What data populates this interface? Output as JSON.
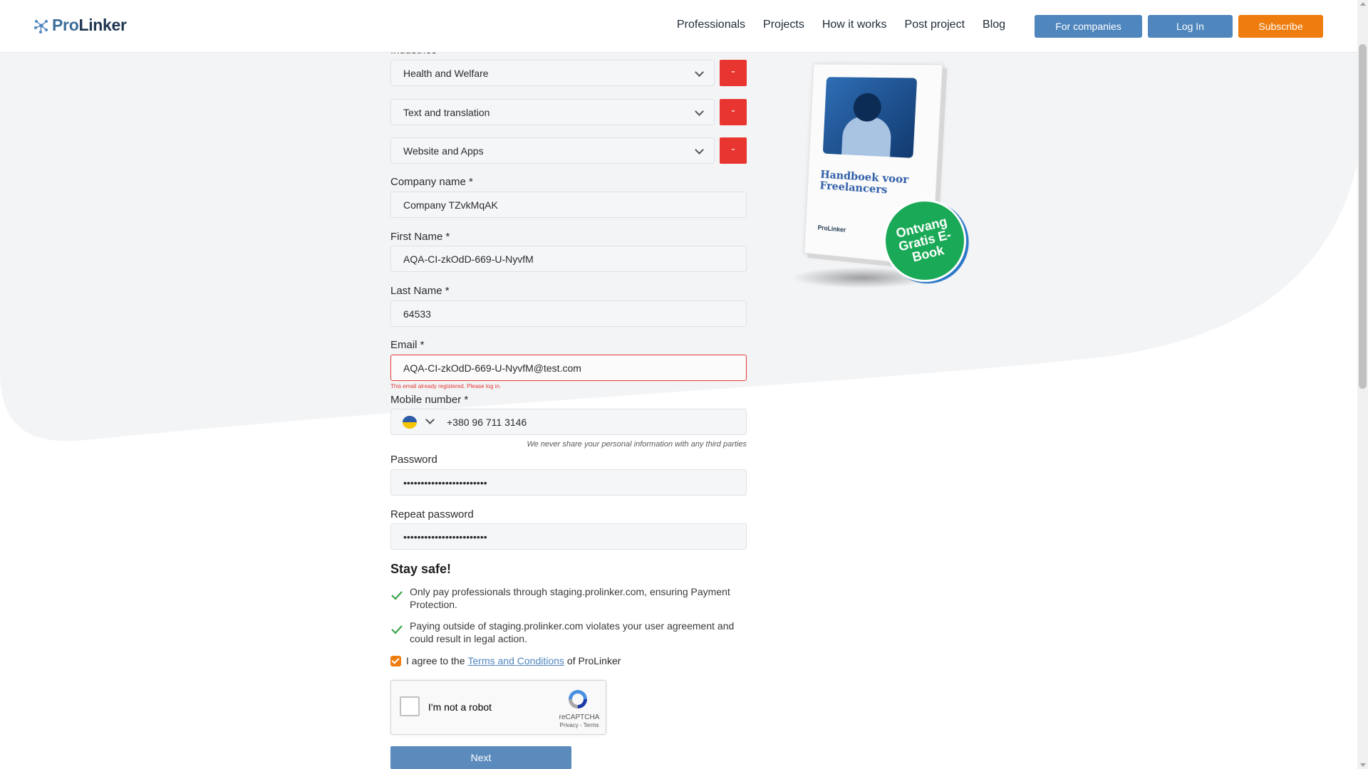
{
  "header": {
    "logo_pro": "Pro",
    "logo_linker": "Linker",
    "nav": [
      "Professionals",
      "Projects",
      "How it works",
      "Post project",
      "Blog"
    ],
    "for_companies": "For companies",
    "login": "Log In",
    "subscribe": "Subscribe",
    "colors": {
      "primary": "#4f86bd",
      "accent": "#ee7c0e"
    }
  },
  "form": {
    "industries_label": "Industries",
    "industries": [
      {
        "value": "Health and Welfare",
        "remove": "-"
      },
      {
        "value": "Text and translation",
        "remove": "-"
      },
      {
        "value": "Website and Apps",
        "remove": "-"
      }
    ],
    "company_label": "Company name *",
    "company_value": "Company TZvkMqAK",
    "first_name_label": "First Name *",
    "first_name_value": "AQA-CI-zkOdD-669-U-NyvfM",
    "last_name_label": "Last Name *",
    "last_name_value": "64533",
    "email_label": "Email *",
    "email_value": "AQA-CI-zkOdD-669-U-NyvfM@test.com",
    "email_error": "This email already registered. Please log in.",
    "mobile_label": "Mobile number *",
    "mobile_value": "+380 96 711 3146",
    "privacy_note": "We never share your personal information with any third parties",
    "password_label": "Password",
    "password_value": "••••••••••••••••••••••••",
    "repeat_password_label": "Repeat password",
    "repeat_password_value": "••••••••••••••••••••••••",
    "stay_safe_title": "Stay safe!",
    "safe_items": [
      "Only pay professionals through staging.prolinker.com, ensuring Payment Protection.",
      "Paying outside of staging.prolinker.com violates your user agreement and could result in legal action."
    ],
    "agree_prefix": "I agree to the",
    "agree_link": "Terms and Conditions",
    "agree_suffix": "of ProLinker",
    "next": "Next",
    "error_color": "#e53935"
  },
  "recaptcha": {
    "label": "I'm not a robot",
    "brand": "reCAPTCHA",
    "links": "Privacy - Terms"
  },
  "ebook": {
    "title": "Handboek voor Freelancers",
    "logo": "ProLinker",
    "badge": "Ontvang Gratis E-Book"
  }
}
